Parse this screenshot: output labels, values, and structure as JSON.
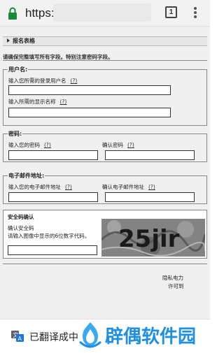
{
  "browser": {
    "url_prefix": "https://",
    "tab_count": "1",
    "accent_color": "#1a8a3a"
  },
  "form": {
    "section_title": "报名表格",
    "instruction": "请确保完整填写所有字段。特别注意密码字段。",
    "help_link": "(?)",
    "username": {
      "legend": "用户名:",
      "login_label": "输入您所需的登录用户名",
      "display_label": "输入所需的显示名称"
    },
    "password": {
      "legend": "密码:",
      "password_label": "输入您的密码",
      "confirm_label": "确认密码"
    },
    "email": {
      "legend": "电子邮件地址:",
      "email_label": "输入您的电子邮件地址",
      "confirm_label": "确认电子邮件地址"
    },
    "captcha": {
      "title": "安全码确认",
      "line1": "确认安全码",
      "line2": "请输入图像中显示的6位数字代码。",
      "image_text": "25jir"
    }
  },
  "footer": {
    "right_line1": "隐私电力",
    "right_line2": "许可到"
  },
  "translate_bar": {
    "status": "已翻译成中",
    "watermark": "辟偶软件园",
    "watermark_color": "#1e8fe3"
  }
}
